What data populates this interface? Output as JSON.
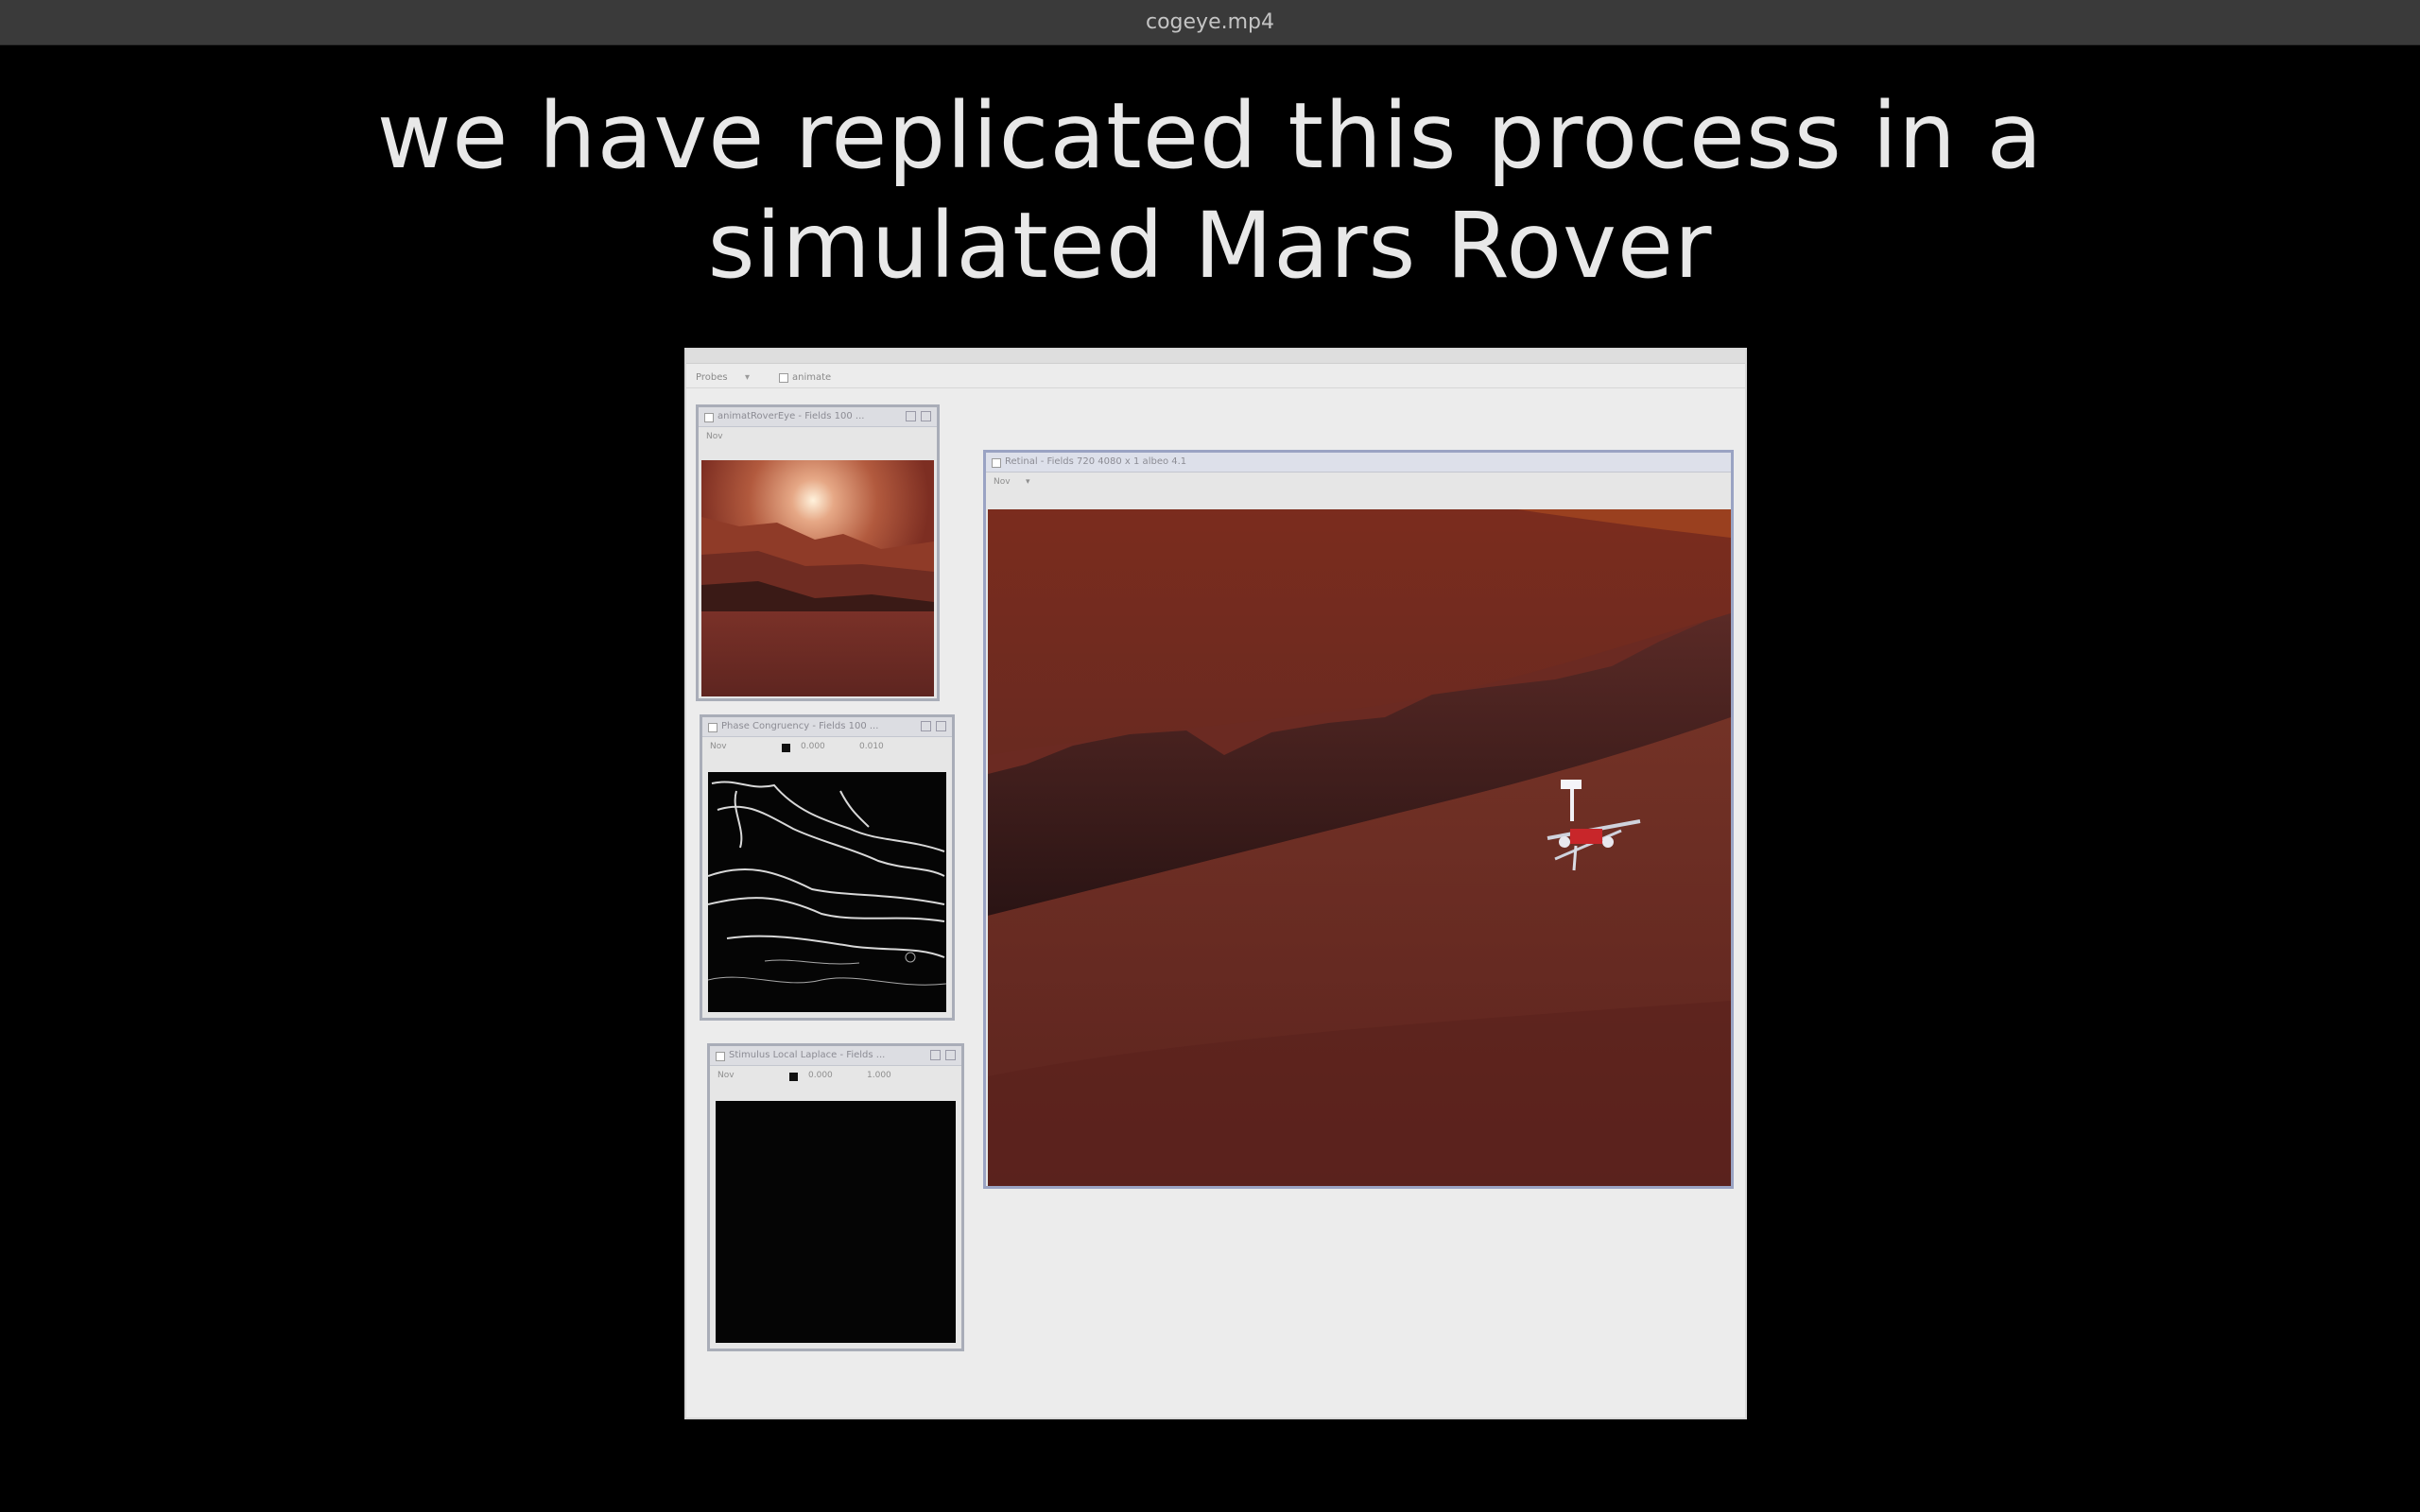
{
  "window": {
    "title": "cogeye.mp4"
  },
  "caption": {
    "line1": "we have replicated this process in a",
    "line2": "simulated Mars Rover"
  },
  "app": {
    "toolbar": {
      "dropdown": "Probes",
      "animate": "animate"
    },
    "panes": {
      "eye": {
        "title": "animatRoverEye - Fields 100 ...",
        "tool": "Nov"
      },
      "contrast": {
        "title": "Phase Congruency - Fields 100 ...",
        "tool": "Nov",
        "min": "0.000",
        "max": "0.010"
      },
      "laplace": {
        "title": "Stimulus Local Laplace - Fields ...",
        "tool": "Nov",
        "min": "0.000",
        "max": "1.000"
      },
      "main": {
        "title": "Retinal - Fields 720 4080 x 1 albeo 4.1",
        "tool": "Nov"
      }
    }
  },
  "colors": {
    "mars_sky": "#8a3a22",
    "mars_ground": "#6e2b20",
    "pane_border": "#9aa3c3"
  },
  "icons": [
    "checkbox-icon",
    "pop-out-icon",
    "close-icon",
    "color-swatch-icon",
    "rover-icon"
  ]
}
